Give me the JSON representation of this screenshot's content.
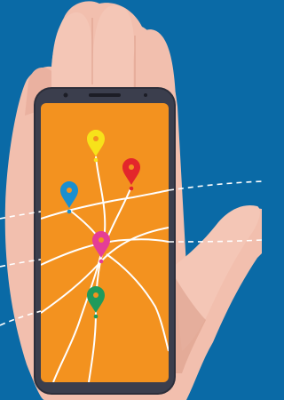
{
  "scene": {
    "background_color": "#0a6aa6",
    "skin_color": "#f2bfae",
    "skin_shadow_color": "#d99a86",
    "phone_frame_color": "#2c2e3a",
    "screen_color": "#f3921f",
    "route_line_color": "#ffffff"
  },
  "pins": [
    {
      "name": "yellow-pin-icon",
      "color": "#f7e21a"
    },
    {
      "name": "red-pin-icon",
      "color": "#e3262b"
    },
    {
      "name": "blue-pin-icon",
      "color": "#1a8fd0"
    },
    {
      "name": "magenta-pin-icon",
      "color": "#e53d96"
    },
    {
      "name": "green-pin-icon",
      "color": "#1f9a5b"
    }
  ]
}
